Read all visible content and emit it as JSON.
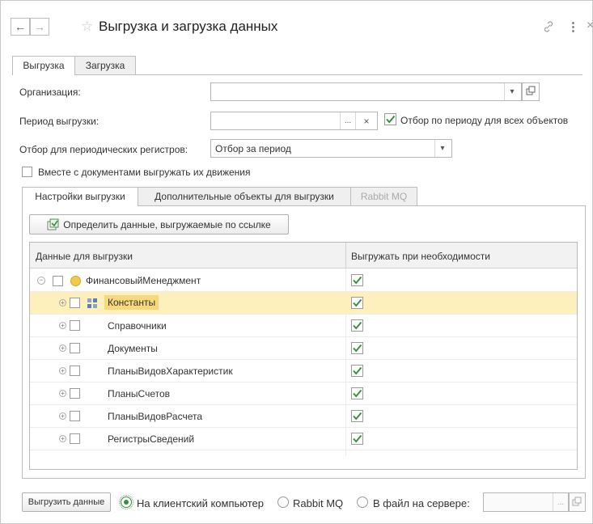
{
  "header": {
    "title": "Выгрузка и загрузка данных",
    "back_icon": "←",
    "forward_icon": "→",
    "star_icon": "☆",
    "link_icon": "🔗",
    "more_icon": "⋮",
    "close_icon": "×"
  },
  "tabs": {
    "export": "Выгрузка",
    "import": "Загрузка"
  },
  "form": {
    "org_label": "Организация:",
    "org_value": "",
    "period_label": "Период выгрузки:",
    "period_value": "",
    "period_check_label": "Отбор по периоду для всех объектов",
    "period_check": true,
    "periodic_label": "Отбор для периодических регистров:",
    "periodic_value": "Отбор за период",
    "movements_label": "Вместе с документами выгружать их движения",
    "movements_check": false
  },
  "inner_tabs": {
    "settings": "Настройки выгрузки",
    "additional": "Дополнительные объекты для выгрузки",
    "rabbit": "Rabbit MQ"
  },
  "define_button": "Определить данные, выгружаемые по ссылке",
  "table": {
    "columns": [
      "Данные для выгрузки",
      "Выгружать при необходимости"
    ],
    "root": {
      "label": "ФинансовыйМенеджмент",
      "checked": true
    },
    "rows": [
      {
        "label": "Константы",
        "checked": true,
        "selected": true
      },
      {
        "label": "Справочники",
        "checked": true
      },
      {
        "label": "Документы",
        "checked": true
      },
      {
        "label": "ПланыВидовХарактеристик",
        "checked": true
      },
      {
        "label": "ПланыСчетов",
        "checked": true
      },
      {
        "label": "ПланыВидовРасчета",
        "checked": true
      },
      {
        "label": "РегистрыСведений",
        "checked": true
      }
    ]
  },
  "footer": {
    "export_button": "Выгрузить данные",
    "radio_client": "На клиентский компьютер",
    "radio_rabbit": "Rabbit MQ",
    "radio_server": "В файл на сервере:",
    "server_path": "",
    "selected": "client"
  },
  "colors": {
    "accent": "#3b8d3f",
    "selected_row": "#fdf0bd"
  }
}
